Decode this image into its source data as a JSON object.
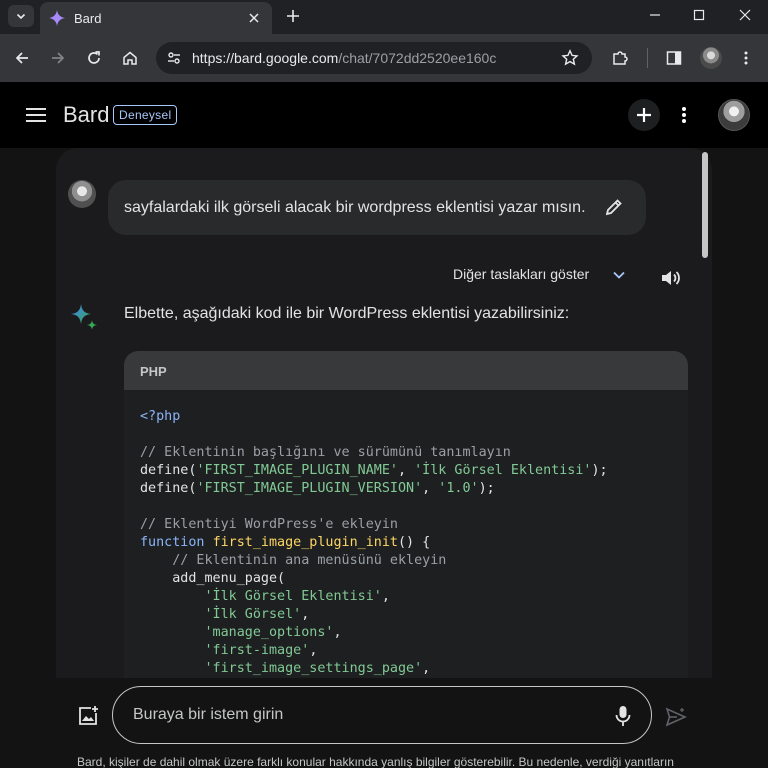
{
  "browser": {
    "tab_title": "Bard",
    "url_host": "https://bard.google.com",
    "url_path": "/chat/7072dd2520ee160c"
  },
  "app": {
    "brand": "Bard",
    "badge": "Deneysel"
  },
  "chat": {
    "user_prompt": "sayfalardaki ilk görseli alacak bir wordpress eklentisi yazar mısın.",
    "drafts_label": "Diğer taslakları göster",
    "response_intro": "Elbette, aşağıdaki kod ile bir WordPress eklentisi yazabilirsiniz:",
    "code_language": "PHP",
    "code_lines": [
      "<?php",
      "",
      "// Eklentinin başlığını ve sürümünü tanımlayın",
      "define('FIRST_IMAGE_PLUGIN_NAME', 'İlk Görsel Eklentisi');",
      "define('FIRST_IMAGE_PLUGIN_VERSION', '1.0');",
      "",
      "// Eklentiyi WordPress'e ekleyin",
      "function first_image_plugin_init() {",
      "    // Eklentinin ana menüsünü ekleyin",
      "    add_menu_page(",
      "        'İlk Görsel Eklentisi',",
      "        'İlk Görsel',",
      "        'manage_options',",
      "        'first-image',",
      "        'first_image_settings_page',"
    ]
  },
  "input": {
    "placeholder": "Buraya bir istem girin"
  },
  "footer": {
    "disclaimer": "Bard, kişiler de dahil olmak üzere farklı konular hakkında yanlış bilgiler gösterebilir. Bu nedenle, verdiği yanıtların"
  },
  "colors": {
    "accent_blue": "#8ab4f8",
    "code_string": "#81c995",
    "code_function": "#fdd663",
    "badge_border": "#a8c7fa"
  }
}
